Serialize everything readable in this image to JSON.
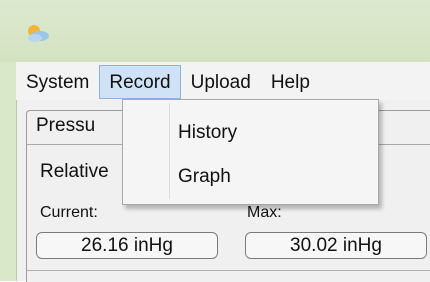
{
  "menu": [
    "System",
    "Record",
    "Upload",
    "Help"
  ],
  "record_menu": {
    "items": [
      "History",
      "Graph"
    ]
  },
  "panel": {
    "tab_label": "Pressu",
    "relative_label": "Relative",
    "current_label": "Current:",
    "current_value": "26.16 inHg",
    "max_label": "Max:",
    "max_value": "30.02 inHg"
  },
  "colors": {
    "titlebar": "#d9e8c9",
    "menu_highlight": "#cfe2f6",
    "menu_highlight_border": "#8fb2d8"
  },
  "icons": {
    "app": "weather-app-icon"
  }
}
